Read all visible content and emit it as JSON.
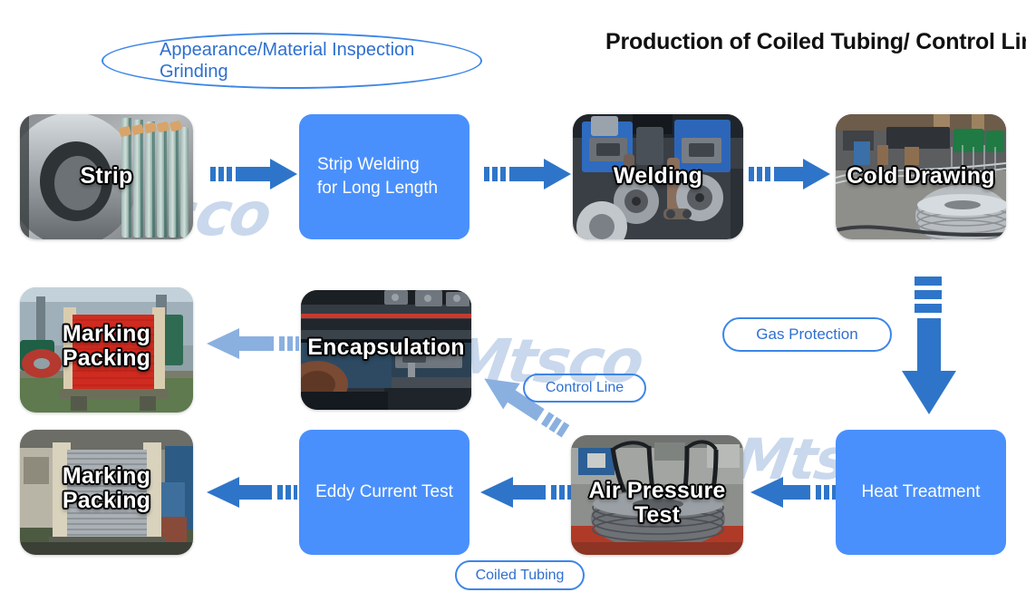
{
  "page": {
    "title": "Production of Coiled Tubing/ Control Line",
    "brand_watermark": "Mtsco",
    "colors": {
      "box_blue": "#4A90FC",
      "arrow_blue": "#2E75C9",
      "arrow_blue_light": "#8AB0E0",
      "oval_border": "#3C86E8",
      "oval_text": "#2E6FD0",
      "title_text": "#111111",
      "watermark": "#C9D8EC"
    }
  },
  "callouts": {
    "inspection": "Appearance/Material Inspection\nGrinding",
    "inspection_line1": "Appearance/Material Inspection",
    "inspection_line2": "Grinding",
    "gas_protection": "Gas Protection",
    "control_line": "Control Line",
    "coiled_tubing": "Coiled Tubing"
  },
  "flow": {
    "row1": [
      {
        "id": "strip",
        "kind": "photo",
        "label": "Strip",
        "subject": "steel-strip-coil"
      },
      {
        "id": "strip-welding",
        "kind": "box",
        "label": "Strip Welding\nfor Long Length",
        "label_line1": "Strip Welding",
        "label_line2": "for Long Length"
      },
      {
        "id": "welding",
        "kind": "photo",
        "label": "Welding",
        "subject": "welding-machine"
      },
      {
        "id": "cold-drawing",
        "kind": "photo",
        "label": "Cold Drawing",
        "subject": "cold-drawing-line"
      }
    ],
    "row2": [
      {
        "id": "marking-packing-control-line",
        "kind": "photo",
        "label": "Marking\nPacking",
        "label_line1": "Marking",
        "label_line2": "Packing",
        "subject": "red-cable-reel"
      },
      {
        "id": "encapsulation",
        "kind": "photo",
        "label": "Encapsulation",
        "subject": "encapsulation-line"
      }
    ],
    "row3": [
      {
        "id": "marking-packing-coiled-tubing",
        "kind": "photo",
        "label": "Marking\nPacking",
        "label_line1": "Marking",
        "label_line2": "Packing",
        "subject": "coiled-tubing-reel"
      },
      {
        "id": "eddy-current-test",
        "kind": "box",
        "label": "Eddy Current Test"
      },
      {
        "id": "air-pressure-test",
        "kind": "photo",
        "label": "Air Pressure Test",
        "subject": "air-pressure-test-coil"
      },
      {
        "id": "heat-treatment",
        "kind": "box",
        "label": "Heat Treatment"
      }
    ]
  },
  "connectors": [
    {
      "id": "strip-to-strip-welding",
      "direction": "right",
      "tone": "dark",
      "dashes": 3
    },
    {
      "id": "strip-welding-to-welding",
      "direction": "right",
      "tone": "dark",
      "dashes": 3
    },
    {
      "id": "welding-to-cold-drawing",
      "direction": "right",
      "tone": "dark",
      "dashes": 3
    },
    {
      "id": "cold-drawing-to-heat-treatment",
      "direction": "down",
      "tone": "dark",
      "dashes": 3
    },
    {
      "id": "encapsulation-to-marking-packing",
      "direction": "left",
      "tone": "light",
      "dashes": 3
    },
    {
      "id": "air-pressure-test-to-encapsulation",
      "direction": "up-left",
      "tone": "light",
      "dashes": 3
    },
    {
      "id": "heat-treatment-to-air-pressure-test",
      "direction": "left",
      "tone": "dark",
      "dashes": 3
    },
    {
      "id": "air-pressure-test-to-eddy-current-test",
      "direction": "left",
      "tone": "dark",
      "dashes": 3
    },
    {
      "id": "eddy-current-test-to-marking-packing",
      "direction": "left",
      "tone": "dark",
      "dashes": 3
    }
  ]
}
